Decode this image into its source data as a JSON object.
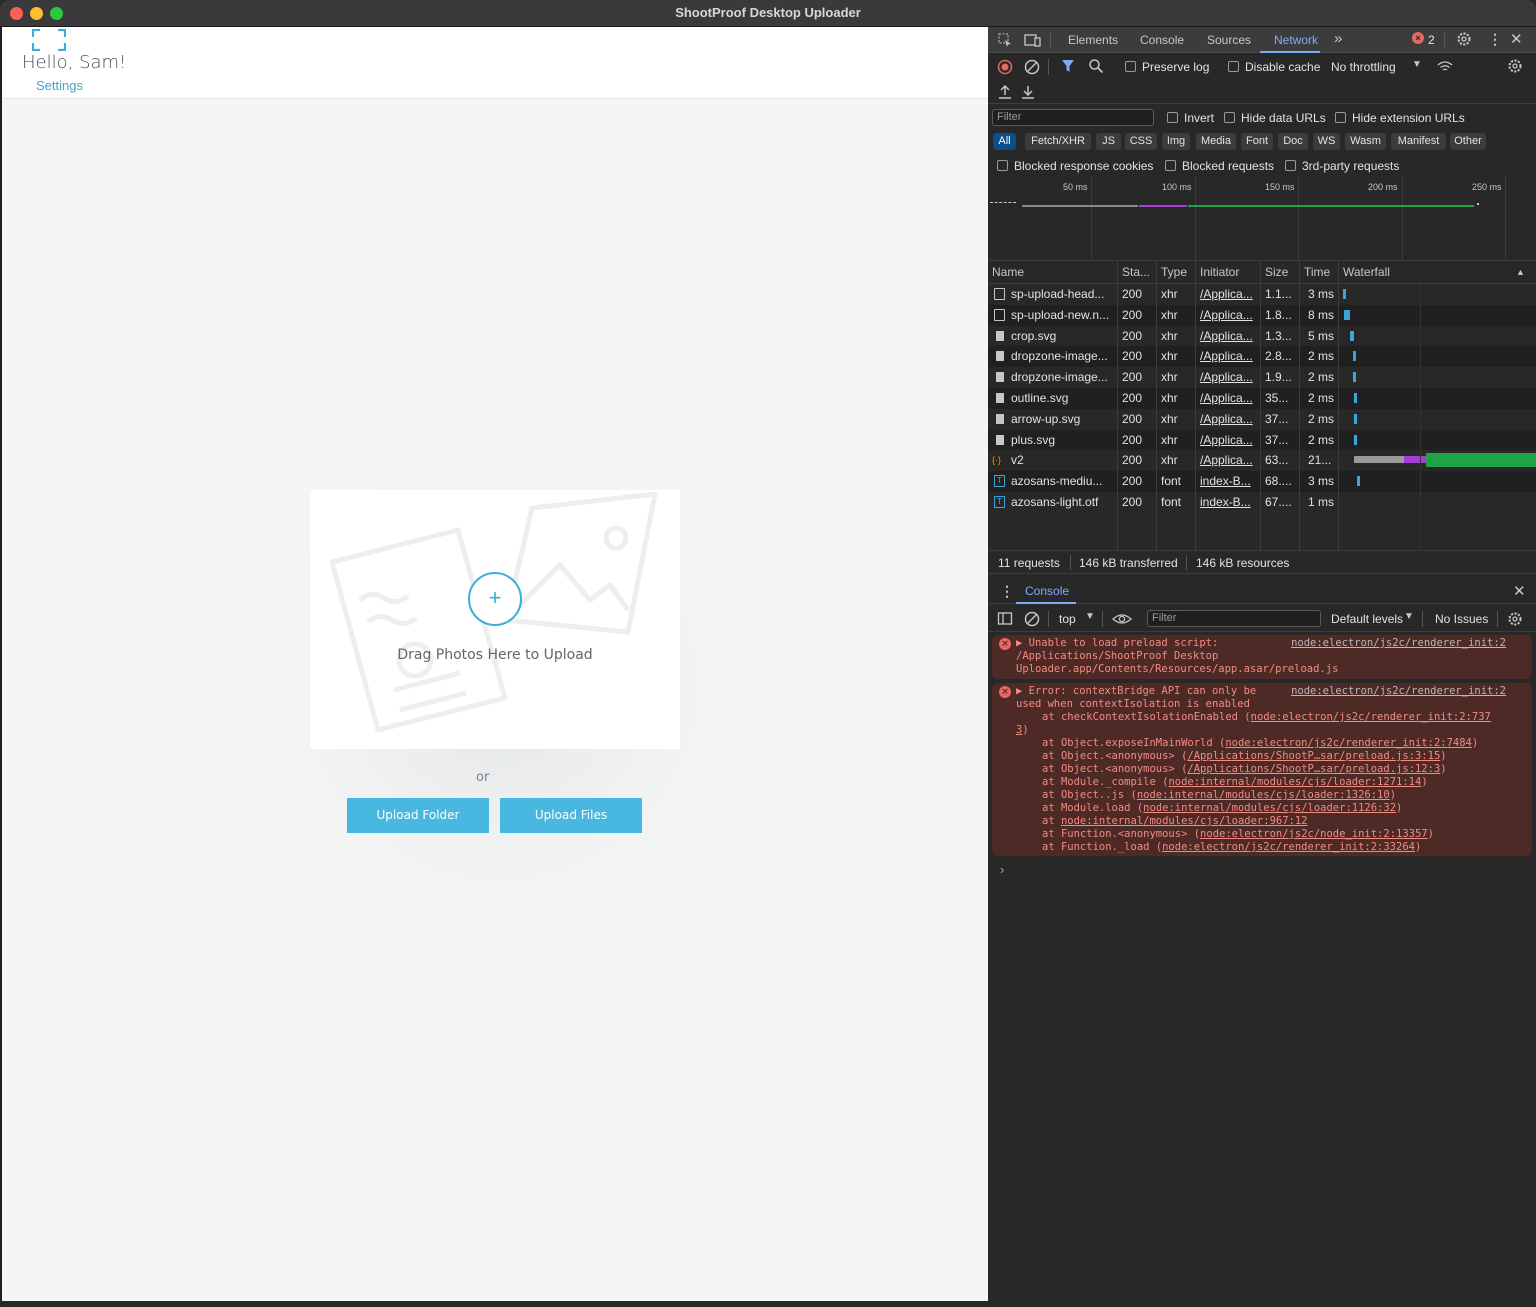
{
  "window": {
    "title": "ShootProof Desktop Uploader"
  },
  "app": {
    "greeting": "Hello, Sam!",
    "settings_link": "Settings",
    "dropzone_text": "Drag Photos Here to Upload",
    "dropzone_plus": "+",
    "or_text": "or",
    "upload_folder": "Upload Folder",
    "upload_files": "Upload Files",
    "accent": "#49b8e0"
  },
  "devtools": {
    "tabs": [
      "Elements",
      "Console",
      "Sources",
      "Network"
    ],
    "more_tabs": "»",
    "error_count": "2",
    "preserve_log": "Preserve log",
    "disable_cache": "Disable cache",
    "throttling": "No throttling",
    "filter_placeholder": "Filter",
    "invert": "Invert",
    "hide_data_urls": "Hide data URLs",
    "hide_extension_urls": "Hide extension URLs",
    "type_filters": [
      "All",
      "Fetch/XHR",
      "JS",
      "CSS",
      "Img",
      "Media",
      "Font",
      "Doc",
      "WS",
      "Wasm",
      "Manifest",
      "Other"
    ],
    "blocked_response_cookies": "Blocked response cookies",
    "blocked_requests": "Blocked requests",
    "third_party": "3rd-party requests",
    "timeline_ticks": [
      "50 ms",
      "100 ms",
      "150 ms",
      "200 ms",
      "250 ms"
    ],
    "columns": [
      "Name",
      "Sta...",
      "Type",
      "Initiator",
      "Size",
      "Time",
      "Waterfall"
    ],
    "requests": [
      {
        "name": "sp-upload-head...",
        "status": "200",
        "type": "xhr",
        "initiator": "/Applica...",
        "size": "1.1...",
        "time": "3 ms",
        "icon": "document-icon"
      },
      {
        "name": "sp-upload-new.n...",
        "status": "200",
        "type": "xhr",
        "initiator": "/Applica...",
        "size": "1.8...",
        "time": "8 ms",
        "icon": "document-icon"
      },
      {
        "name": "crop.svg",
        "status": "200",
        "type": "xhr",
        "initiator": "/Applica...",
        "size": "1.3...",
        "time": "5 ms",
        "icon": "image-icon"
      },
      {
        "name": "dropzone-image...",
        "status": "200",
        "type": "xhr",
        "initiator": "/Applica...",
        "size": "2.8...",
        "time": "2 ms",
        "icon": "image-icon"
      },
      {
        "name": "dropzone-image...",
        "status": "200",
        "type": "xhr",
        "initiator": "/Applica...",
        "size": "1.9...",
        "time": "2 ms",
        "icon": "image-icon"
      },
      {
        "name": "outline.svg",
        "status": "200",
        "type": "xhr",
        "initiator": "/Applica...",
        "size": "35...",
        "time": "2 ms",
        "icon": "image-icon"
      },
      {
        "name": "arrow-up.svg",
        "status": "200",
        "type": "xhr",
        "initiator": "/Applica...",
        "size": "37...",
        "time": "2 ms",
        "icon": "image-icon"
      },
      {
        "name": "plus.svg",
        "status": "200",
        "type": "xhr",
        "initiator": "/Applica...",
        "size": "37...",
        "time": "2 ms",
        "icon": "image-icon"
      },
      {
        "name": "v2",
        "status": "200",
        "type": "xhr",
        "initiator": "/Applica...",
        "size": "63...",
        "time": "21...",
        "icon": "fetch-icon"
      },
      {
        "name": "azosans-mediu...",
        "status": "200",
        "type": "font",
        "initiator": "index-B...",
        "size": "68....",
        "time": "3 ms",
        "icon": "font-icon"
      },
      {
        "name": "azosans-light.otf",
        "status": "200",
        "type": "font",
        "initiator": "index-B...",
        "size": "67....",
        "time": "1 ms",
        "icon": "font-icon"
      }
    ],
    "summary": {
      "requests": "11 requests",
      "transferred": "146 kB transferred",
      "resources": "146 kB resources"
    },
    "console_tab": "Console",
    "context": "top",
    "console_filter": "Filter",
    "levels": "Default levels",
    "issues": "No Issues",
    "errors": [
      {
        "message_line1": "Unable to load preload script:",
        "message_line2": "/Applications/ShootProof Desktop",
        "message_line3": "Uploader.app/Contents/Resources/app.asar/preload.js",
        "source": "node:electron/js2c/renderer_init:2"
      },
      {
        "message_line1": "Error: contextBridge API can only be",
        "message_line2": "used when contextIsolation is enabled",
        "source": "node:electron/js2c/renderer_init:2",
        "stack": [
          {
            "pre": "at checkContextIsolationEnabled (",
            "link": "node:electron/js2c/renderer_init:2:737",
            "post": ""
          },
          {
            "pre": "",
            "link": "3",
            "post": ")"
          },
          {
            "pre": "at Object.exposeInMainWorld (",
            "link": "node:electron/js2c/renderer_init:2:7484",
            "post": ")"
          },
          {
            "pre": "at Object.<anonymous> (",
            "link": "/Applications/ShootP…sar/preload.js:3:15",
            "post": ")"
          },
          {
            "pre": "at Object.<anonymous> (",
            "link": "/Applications/ShootP…sar/preload.js:12:3",
            "post": ")"
          },
          {
            "pre": "at Module._compile (",
            "link": "node:internal/modules/cjs/loader:1271:14",
            "post": ")"
          },
          {
            "pre": "at Object..js (",
            "link": "node:internal/modules/cjs/loader:1326:10",
            "post": ")"
          },
          {
            "pre": "at Module.load (",
            "link": "node:internal/modules/cjs/loader:1126:32",
            "post": ")"
          },
          {
            "pre": "at ",
            "link": "node:internal/modules/cjs/loader:967:12",
            "post": ""
          },
          {
            "pre": "at Function.<anonymous> (",
            "link": "node:electron/js2c/node_init:2:13357",
            "post": ")"
          },
          {
            "pre": "at Function._load (",
            "link": "node:electron/js2c/renderer_init:2:33264",
            "post": ")"
          }
        ]
      }
    ],
    "prompt": "›"
  }
}
